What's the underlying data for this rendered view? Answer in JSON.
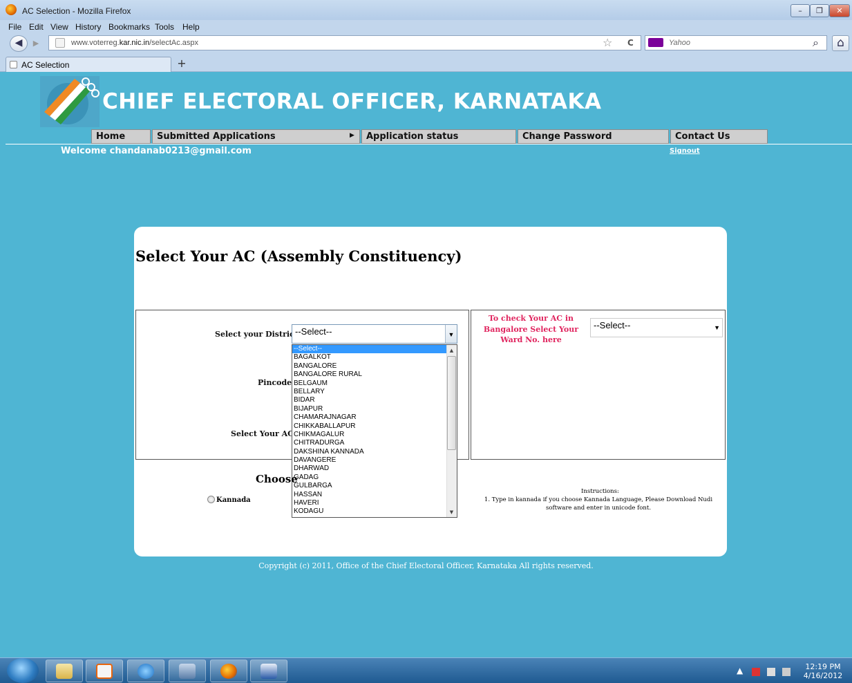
{
  "window": {
    "title": "AC Selection - Mozilla Firefox",
    "min": "–",
    "max": "❐",
    "close": "✕"
  },
  "menubar": [
    "File",
    "Edit",
    "View",
    "History",
    "Bookmarks",
    "Tools",
    "Help"
  ],
  "browser": {
    "url_prefix": "www.voterreg.",
    "url_domain": "kar.nic.in",
    "url_path": "/selectAc.aspx",
    "search_engine": "Yahoo",
    "tab_title": "AC Selection",
    "new_tab": "+",
    "back": "◀",
    "forward": "▶",
    "star": "☆",
    "reload": "C",
    "search_icon": "⌕",
    "home_icon": "⌂"
  },
  "site": {
    "title": "CHIEF ELECTORAL OFFICER, KARNATAKA",
    "nav": [
      "Home",
      "Submitted Applications",
      "Application status",
      "Change Password",
      "Contact Us"
    ],
    "welcome": "Welcome chandanab0213@gmail.com",
    "signout": "Signout"
  },
  "form": {
    "heading": "Select Your AC (Assembly Constituency)",
    "district_label": "Select your District :",
    "district_value": "--Select--",
    "pincode_label": "Pincode :",
    "ac_label": "Select Your AC :",
    "district_options": [
      "--Select--",
      "BAGALKOT",
      "BANGALORE",
      "BANGALORE RURAL",
      "BELGAUM",
      "BELLARY",
      "BIDAR",
      "BIJAPUR",
      "CHAMARAJNAGAR",
      "CHIKKABALLAPUR",
      "CHIKMAGALUR",
      "CHITRADURGA",
      "DAKSHINA KANNADA",
      "DAVANGERE",
      "DHARWAD",
      "GADAG",
      "GULBARGA",
      "HASSAN",
      "HAVERI",
      "KODAGU"
    ],
    "ward_label": "To check Your AC in Bangalore Select Your Ward No. here",
    "ward_value": "--Select--",
    "choose_label": "Choose",
    "language_option": "Kannada",
    "instructions_title": "Instructions:",
    "instructions_text": "1. Type in kannada if you choose Kannada Language, Please Download Nudi software and enter in unicode font."
  },
  "footer": {
    "copyright": "Copyright (c) 2011, Office of the Chief Electoral Officer, Karnataka All rights reserved."
  },
  "taskbar": {
    "time": "12:19 PM",
    "date": "4/16/2012",
    "apps": [
      "explorer",
      "media-player",
      "internet-explorer",
      "network",
      "firefox",
      "word"
    ]
  },
  "colors": {
    "page_bg": "#4fb5d3",
    "ward_label": "#e0245e",
    "list_selected": "#3399ff"
  }
}
